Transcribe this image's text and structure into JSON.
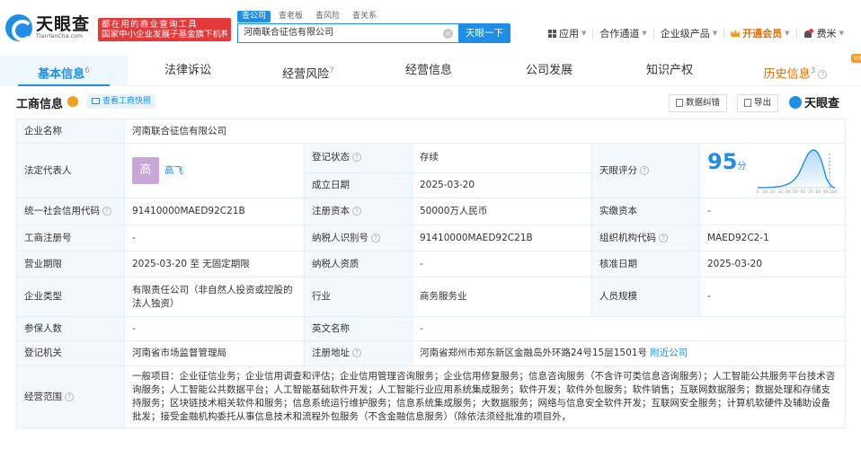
{
  "header": {
    "logo_cn": "天眼查",
    "logo_en": "TianYanCha.com",
    "banner_line1": "都在用的商业查询工具",
    "banner_line2": "国家中小企业发展子基金旗下机构",
    "search_tabs": [
      "查公司",
      "查老板",
      "查风险",
      "查关系"
    ],
    "search_value": "河南联合征信有限公司",
    "search_button": "天眼一下",
    "nav": [
      "应用",
      "合作通道",
      "企业级产品",
      "开通会员",
      "费米"
    ]
  },
  "tabs": [
    {
      "label": "基本信息",
      "count": "6"
    },
    {
      "label": "法律诉讼",
      "count": ""
    },
    {
      "label": "经营风险",
      "count": "7"
    },
    {
      "label": "经营信息",
      "count": ""
    },
    {
      "label": "公司发展",
      "count": ""
    },
    {
      "label": "知识产权",
      "count": ""
    },
    {
      "label": "历史信息",
      "count": "3"
    }
  ],
  "vip_tag": "VIP",
  "section": {
    "title": "工商信息",
    "snapshot_btn": "查看工商快照",
    "correct_btn": "数据纠错",
    "export_btn": "导出",
    "brand": "天眼查"
  },
  "info": {
    "company_name_label": "企业名称",
    "company_name": "河南联合征信有限公司",
    "legal_rep_label": "法定代表人",
    "legal_rep_avatar": "高",
    "legal_rep": "高飞",
    "reg_status_label": "登记状态",
    "reg_status": "存续",
    "est_date_label": "成立日期",
    "est_date": "2025-03-20",
    "score_label": "天眼评分",
    "score": "95",
    "score_unit": "分",
    "credit_code_label": "统一社会信用代码",
    "credit_code": "91410000MAED92C21B",
    "reg_capital_label": "注册资本",
    "reg_capital": "50000万人民币",
    "paid_capital_label": "实缴资本",
    "paid_capital": "-",
    "reg_no_label": "工商注册号",
    "reg_no": "-",
    "taxpayer_id_label": "纳税人识别号",
    "taxpayer_id": "91410000MAED92C21B",
    "org_code_label": "组织机构代码",
    "org_code": "MAED92C2-1",
    "term_label": "营业期限",
    "term": "2025-03-20 至 无固定期限",
    "taxpayer_qual_label": "纳税人资质",
    "taxpayer_qual": "-",
    "approval_date_label": "核准日期",
    "approval_date": "2025-03-20",
    "type_label": "企业类型",
    "type": "有限责任公司（非自然人投资或控股的法人独资）",
    "industry_label": "行业",
    "industry": "商务服务业",
    "staff_label": "人员规模",
    "staff": "-",
    "insured_label": "参保人数",
    "insured": "-",
    "en_name_label": "英文名称",
    "en_name": "-",
    "authority_label": "登记机关",
    "authority": "河南省市场监督管理局",
    "address_label": "注册地址",
    "address": "河南省郑州市郑东新区金融岛外环路24号15层1501号",
    "nearby_link": "附近公司",
    "scope_label": "经营范围",
    "scope": "一般项目：企业征信业务；企业信用调查和评估；企业信用管理咨询服务；企业信用修复服务；信息咨询服务（不含许可类信息咨询服务）；人工智能公共服务平台技术咨询服务；人工智能公共数据平台；人工智能基础软件开发；人工智能行业应用系统集成服务；软件开发；软件外包服务；软件销售；互联网数据服务；数据处理和存储支持服务；区块链技术相关软件和服务；信息系统运行维护服务；信息系统集成服务；大数据服务；网络与信息安全软件开发；互联网安全服务；计算机软硬件及辅助设备批发；接受金融机构委托从事信息技术和流程外包服务（不含金融信息服务）（除依法须经批准的项目外，"
  },
  "score_curve_ticks": [
    "0",
    "10",
    "20",
    "30",
    "40",
    "50",
    "60",
    "70",
    "80",
    "90",
    "100"
  ],
  "colors": {
    "accent": "#1e8ee6",
    "status_green": "#21a65a",
    "vip_orange": "#e86a00",
    "banner_red": "#e5383b"
  }
}
